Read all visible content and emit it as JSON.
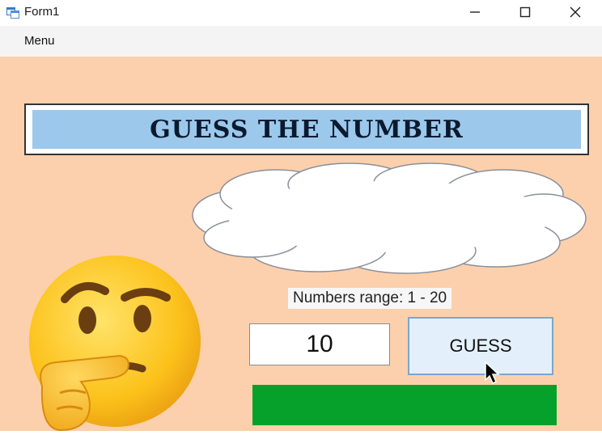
{
  "window": {
    "title": "Form1",
    "icons": {
      "app": "app-form-icon",
      "minimize": "minimize-icon",
      "maximize": "maximize-icon",
      "close": "close-icon"
    }
  },
  "menu": {
    "items": [
      {
        "label": "Menu"
      }
    ]
  },
  "game": {
    "title": "GUESS THE NUMBER",
    "range_label": "Numbers range: 1 - 20",
    "guess_value": "10",
    "guess_button_label": "GUESS",
    "result_text": "",
    "emoji_icon": "thinking-face-icon",
    "cloud_icon": "speech-cloud-icon"
  },
  "colors": {
    "background": "#fcd0ac",
    "title_fill": "#9cc8ec",
    "result_bar": "#06a12a",
    "button_fill": "#e3f0fb"
  }
}
